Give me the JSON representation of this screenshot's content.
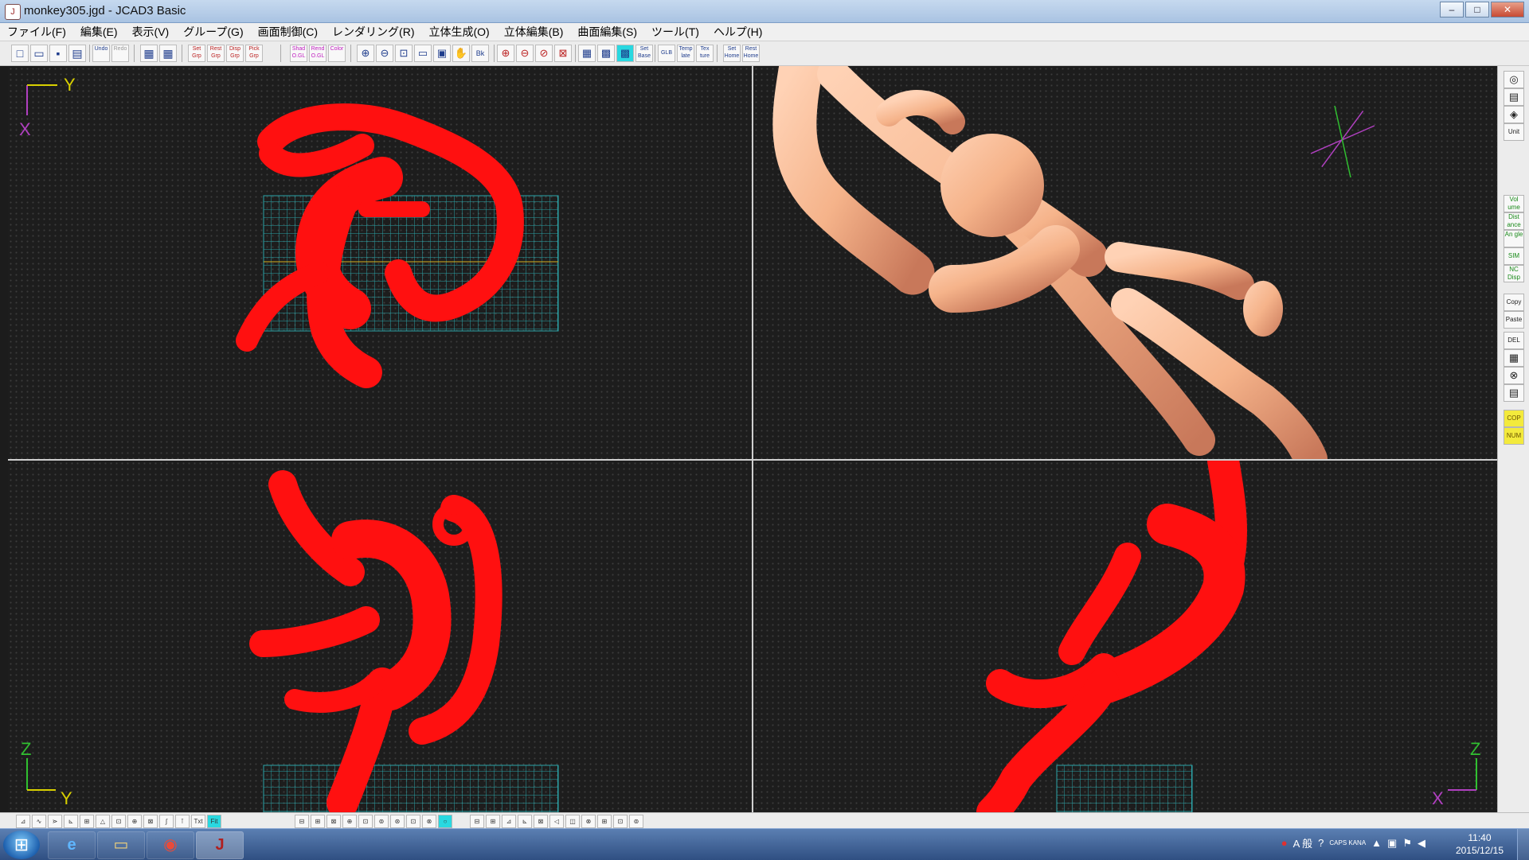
{
  "window": {
    "title": "monkey305.jgd - JCAD3 Basic",
    "icon": "app-icon",
    "minimize": "–",
    "maximize": "□",
    "close": "✕"
  },
  "menu": [
    {
      "label": "ファイル(F)"
    },
    {
      "label": "編集(E)"
    },
    {
      "label": "表示(V)"
    },
    {
      "label": "グループ(G)"
    },
    {
      "label": "画面制御(C)"
    },
    {
      "label": "レンダリング(R)"
    },
    {
      "label": "立体生成(O)"
    },
    {
      "label": "立体編集(B)"
    },
    {
      "label": "曲面編集(S)"
    },
    {
      "label": "ツール(T)"
    },
    {
      "label": "ヘルプ(H)"
    }
  ],
  "toolbar": {
    "new": "□",
    "open": "▭",
    "save": "▪",
    "print": "▤",
    "undo": "Undo",
    "redo": "Redo",
    "grp1": "▦",
    "grp2": "▦",
    "set_grp": "Set Grp",
    "rest_grp": "Rest Grp",
    "disp_grp": "Disp Grp",
    "pick_grp": "Pick Grp",
    "shad_ogl": "Shad O.GL",
    "rend_ogl": "Rend O.GL",
    "color": "Color",
    "zoom_in": "⊕",
    "zoom_out": "⊖",
    "zoom_fit": "⊡",
    "zoom_win": "▭",
    "zoom_all": "▣",
    "pan": "✋",
    "back": "Bk",
    "zoom2": "⊕",
    "zoom3": "⊖",
    "zoom4": "⊘",
    "zoom5": "⊠",
    "grid1": "▦",
    "grid2": "▩",
    "grid3": "▩",
    "set_base": "Set Base",
    "glb": "GLB",
    "template": "Temp late",
    "texture": "Tex ture",
    "set_home": "Set Home",
    "rest_home": "Rest Home"
  },
  "viewports": {
    "top": {
      "axis_h": "Y",
      "axis_v": "X"
    },
    "front": {
      "axis_h": "Y",
      "axis_v": "Z"
    },
    "side": {
      "axis_h": "X",
      "axis_v": "Z"
    }
  },
  "right_toolbar": {
    "b1": "◎",
    "b2": "▤",
    "b3": "◈",
    "unit": "Unit",
    "volume": "Vol ume",
    "distance": "Dist ance",
    "angle": "An gle",
    "sim": "SIM",
    "nc_disp": "NC Disp",
    "copy": "Copy",
    "paste": "Paste",
    "del": "DEL",
    "b4": "▦",
    "b5": "⊗",
    "b6": "▤",
    "cop": "COP",
    "num": "NUM"
  },
  "bottom_toolbar": {
    "items": [
      "⊿",
      "∿",
      "⋗",
      "⊾",
      "⊞",
      "△",
      "⊡",
      "⊕",
      "⊠",
      "∫",
      "⊺",
      "Txt",
      "Fit",
      "⊟",
      "⊞",
      "⊠",
      "⊕",
      "⊡",
      "⊚",
      "⊛",
      "⊡",
      "⊗",
      "○",
      "⊟",
      "⊞",
      "⊿",
      "⊾",
      "⊠",
      "◁",
      "◫",
      "⊗",
      "⊞",
      "⊡",
      "⊚"
    ]
  },
  "taskbar": {
    "start": "⊞",
    "apps": [
      {
        "name": "ie",
        "glyph": "e"
      },
      {
        "name": "explorer",
        "glyph": "▭"
      },
      {
        "name": "chrome",
        "glyph": "◉"
      },
      {
        "name": "jcad",
        "glyph": "J"
      }
    ],
    "tray": {
      "ime": "A 般",
      "caps": "CAPS KANA"
    },
    "time": "11:40",
    "date": "2015/12/15"
  },
  "colors": {
    "wire": "#ff1010",
    "shaded": "#f5b38a",
    "grid": "#2aa3a8",
    "axis_y": "#d8d000",
    "axis_x": "#b040c0",
    "axis_z": "#30c030"
  }
}
